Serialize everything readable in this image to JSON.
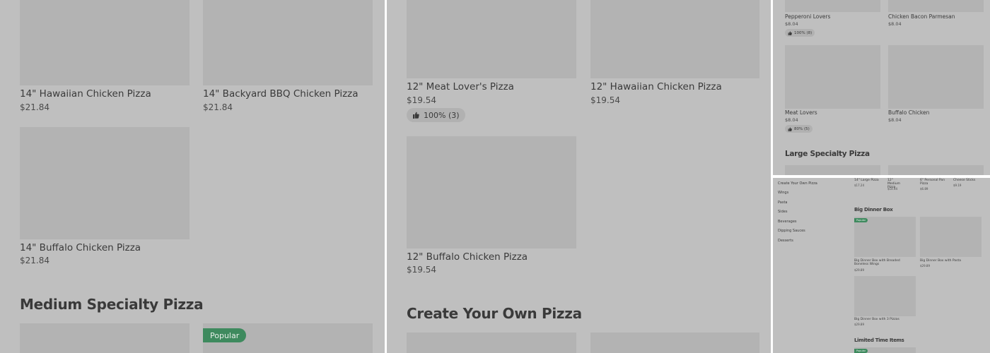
{
  "panel1": {
    "items": [
      {
        "name": "14\" Hawaiian Chicken Pizza",
        "price": "$21.84"
      },
      {
        "name": "14\" Backyard BBQ Chicken Pizza",
        "price": "$21.84"
      },
      {
        "name": "14\" Buffalo Chicken Pizza",
        "price": "$21.84"
      }
    ],
    "section_title": "Medium Specialty Pizza",
    "popular_badge": "Popular"
  },
  "panel2": {
    "items": [
      {
        "name": "12\" Meat Lover's Pizza",
        "price": "$19.54",
        "rating": "100% (3)"
      },
      {
        "name": "12\" Hawaiian Chicken Pizza",
        "price": "$19.54"
      },
      {
        "name": "12\" Buffalo Chicken Pizza",
        "price": "$19.54"
      }
    ],
    "section_title": "Create Your Own Pizza"
  },
  "panel3": {
    "items": [
      {
        "name": "Pepperoni Lovers",
        "price": "$8.04",
        "rating": "100% (8)"
      },
      {
        "name": "Chicken Bacon Parmesan",
        "price": "$8.04"
      },
      {
        "name": "Meat Lovers",
        "price": "$8.04",
        "rating": "80% (5)"
      },
      {
        "name": "Buffalo Chicken",
        "price": "$8.04"
      }
    ],
    "section_title": "Large Specialty Pizza"
  },
  "panel4": {
    "nav": [
      "Create Your Own Pizza",
      "Wings",
      "Pasta",
      "Sides",
      "Beverages",
      "Dipping Sauces",
      "Desserts"
    ],
    "top_items": [
      {
        "name": "14\" Large Pizza",
        "price": "$17.24"
      },
      {
        "name": "12\" Medium Pizza",
        "price": "$14.94"
      },
      {
        "name": "6\" Personal Pan Pizza",
        "price": "$6.89"
      },
      {
        "name": "Cheese Sticks",
        "price": "$9.19"
      }
    ],
    "section_title": "Big Dinner Box",
    "popular_badge": "Popular",
    "items": [
      {
        "name": "Big Dinner Box with Breaded Boneless Wings",
        "price": "$29.89"
      },
      {
        "name": "Big Dinner Box with Pasta",
        "price": "$29.89"
      },
      {
        "name": "Big Dinner Box with 3 Pizzas",
        "price": "$29.89"
      }
    ],
    "section_title_2": "Limited Time Items",
    "popular_badge_2": "Popular"
  },
  "icons": {
    "thumb": "thumbs-up-icon"
  },
  "colors": {
    "background": "#bfbfbf",
    "placeholder": "#b3b3b3",
    "popular_badge": "#3e8a5e"
  }
}
